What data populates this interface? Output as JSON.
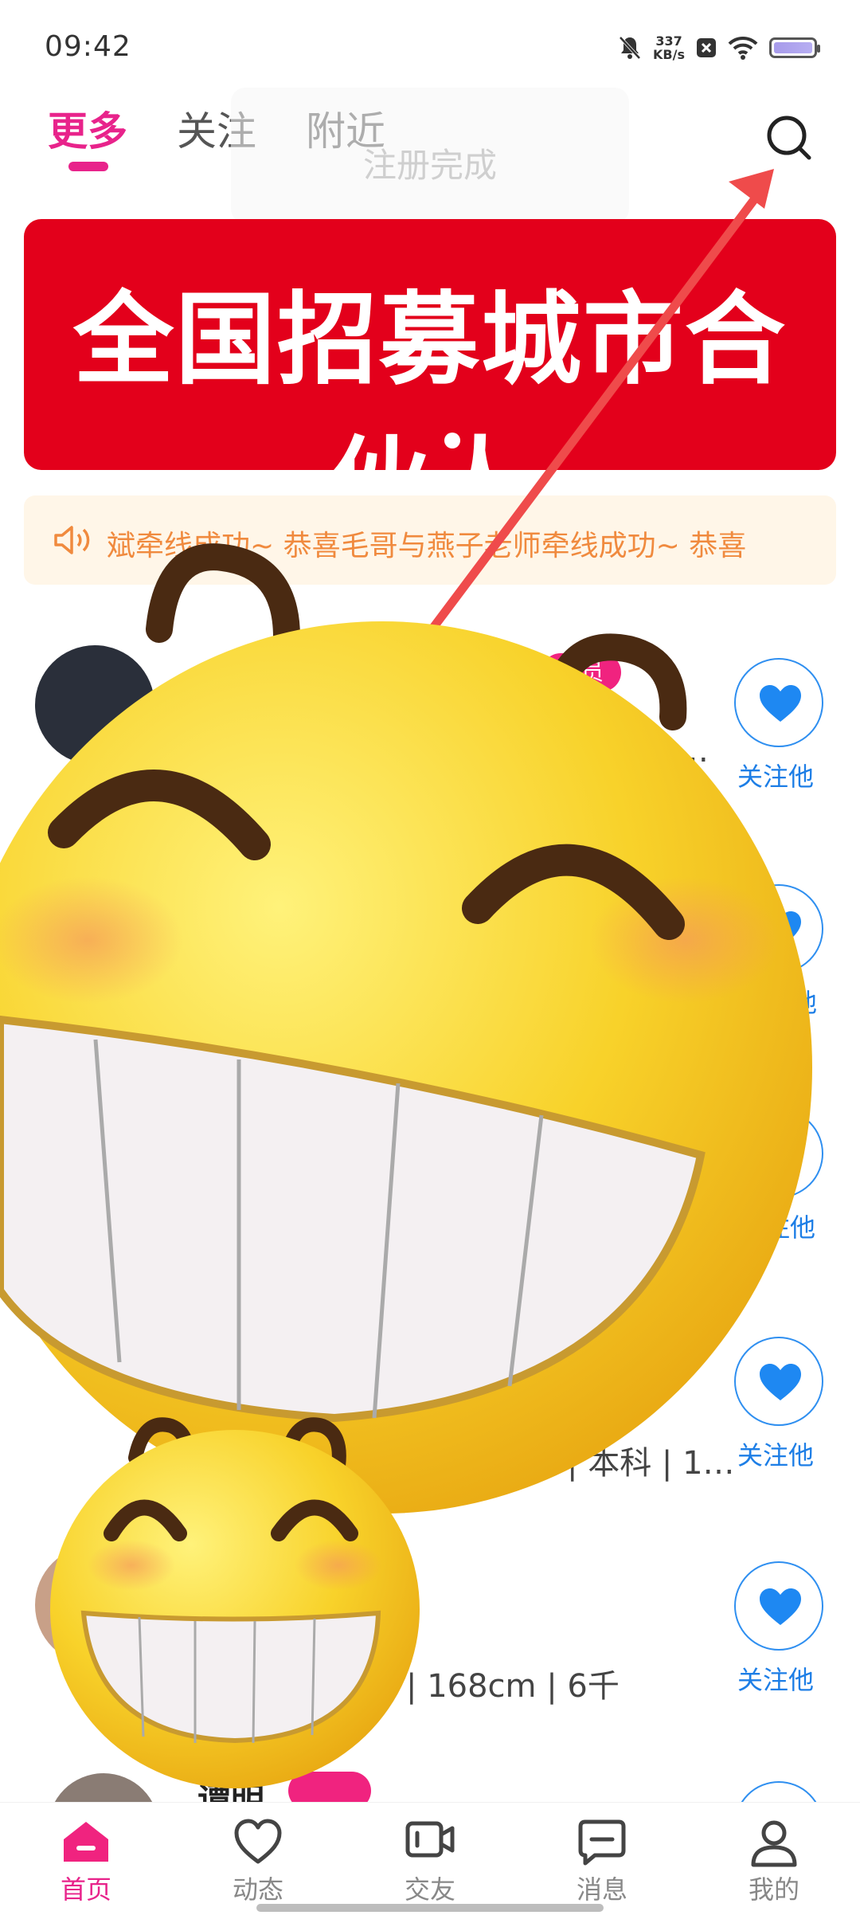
{
  "status_bar": {
    "time": "09:42",
    "net_speed_value": "337",
    "net_speed_unit": "KB/s",
    "icons": [
      "mute-bell-icon",
      "notification-x-icon",
      "wifi-icon",
      "battery-icon"
    ]
  },
  "top_tabs": {
    "items": [
      "更多",
      "关注",
      "附近"
    ],
    "active_index": 0,
    "search_icon": "search-icon"
  },
  "toast": {
    "text": "注册完成"
  },
  "banner": {
    "text": "全国招募城市合伙人",
    "indicator_count": 1,
    "active_index": 0
  },
  "notice": {
    "icon": "speaker-icon",
    "text": "斌牵线成功~ 恭喜毛哥与燕子老师牵线成功~ 恭喜"
  },
  "users": [
    {
      "name": "",
      "badge": "会员",
      "info": "…",
      "follow_label": "关注他"
    },
    {
      "name": "",
      "badge": "",
      "info": "",
      "follow_label": "他"
    },
    {
      "name": "",
      "badge": "",
      "info": "",
      "follow_label": "注他"
    },
    {
      "name": "",
      "badge": "",
      "info": "| 本科 | 1…",
      "follow_label": "关注他"
    },
    {
      "name": "",
      "badge": "",
      "info": "| 168cm | 6千",
      "follow_label": "关注他"
    },
    {
      "name": "谭明",
      "badge": "",
      "info": "",
      "follow_label": ""
    }
  ],
  "bottom_nav": {
    "items": [
      {
        "label": "首页",
        "icon": "home-icon"
      },
      {
        "label": "动态",
        "icon": "heart-icon"
      },
      {
        "label": "交友",
        "icon": "video-camera-icon"
      },
      {
        "label": "消息",
        "icon": "message-icon"
      },
      {
        "label": "我的",
        "icon": "person-icon"
      }
    ],
    "active_index": 0
  },
  "colors": {
    "accent_pink": "#e8238b",
    "banner_red": "#e3001b",
    "follow_blue": "#1d7ee6",
    "notice_orange": "#f08a3e",
    "arrow_red": "#ef4b4b"
  }
}
